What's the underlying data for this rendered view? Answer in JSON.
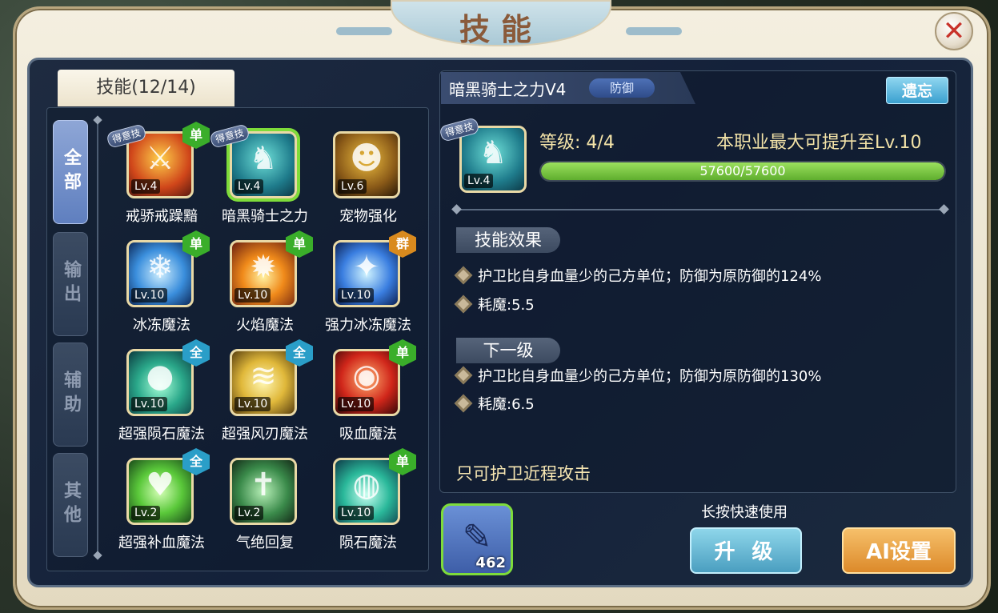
{
  "window": {
    "title": "技能",
    "close_glyph": "✕"
  },
  "skill_tab_label": "技能(12/14)",
  "categories": [
    {
      "label": "全部",
      "active": true
    },
    {
      "label": "输出",
      "active": false
    },
    {
      "label": "辅助",
      "active": false
    },
    {
      "label": "其他",
      "active": false
    }
  ],
  "skills": [
    {
      "name": "戒骄戒躁黯",
      "level": "Lv.4",
      "badge": "单",
      "favorite": "得意技"
    },
    {
      "name": "暗黑骑士之力",
      "level": "Lv.4",
      "badge": "",
      "favorite": "得意技",
      "selected": true
    },
    {
      "name": "宠物强化",
      "level": "Lv.6",
      "badge": ""
    },
    {
      "name": "冰冻魔法",
      "level": "Lv.10",
      "badge": "单"
    },
    {
      "name": "火焰魔法",
      "level": "Lv.10",
      "badge": "单"
    },
    {
      "name": "强力冰冻魔法",
      "level": "Lv.10",
      "badge": "群"
    },
    {
      "name": "超强陨石魔法",
      "level": "Lv.10",
      "badge": "全"
    },
    {
      "name": "超强风刃魔法",
      "level": "Lv.10",
      "badge": "全"
    },
    {
      "name": "吸血魔法",
      "level": "Lv.10",
      "badge": "单"
    },
    {
      "name": "超强补血魔法",
      "level": "Lv.2",
      "badge": "全"
    },
    {
      "name": "气绝回复",
      "level": "Lv.2",
      "badge": ""
    },
    {
      "name": "陨石魔法",
      "level": "Lv.10",
      "badge": "单"
    }
  ],
  "detail": {
    "skill_title": "暗黑骑士之力V4",
    "type_tag": "防御",
    "forget_label": "遗忘",
    "favorite": "得意技",
    "icon_level": "Lv.4",
    "level_text": "等级: 4/4",
    "max_text": "本职业最大可提升至Lv.10",
    "xp_text": "57600/57600",
    "xp_ratio": 1.0,
    "effect_title": "技能效果",
    "effect_lines": [
      "护卫比自身血量少的己方单位；防御为原防御的124%",
      "耗魔:5.5"
    ],
    "next_title": "下一级",
    "next_lines": [
      "护卫比自身血量少的己方单位；防御为原防御的130%",
      "耗魔:6.5"
    ],
    "note": "只可护卫近程攻击"
  },
  "item": {
    "count": "462"
  },
  "hint": "长按快速使用",
  "buttons": {
    "upgrade": "升 级",
    "ai": "AI设置"
  }
}
